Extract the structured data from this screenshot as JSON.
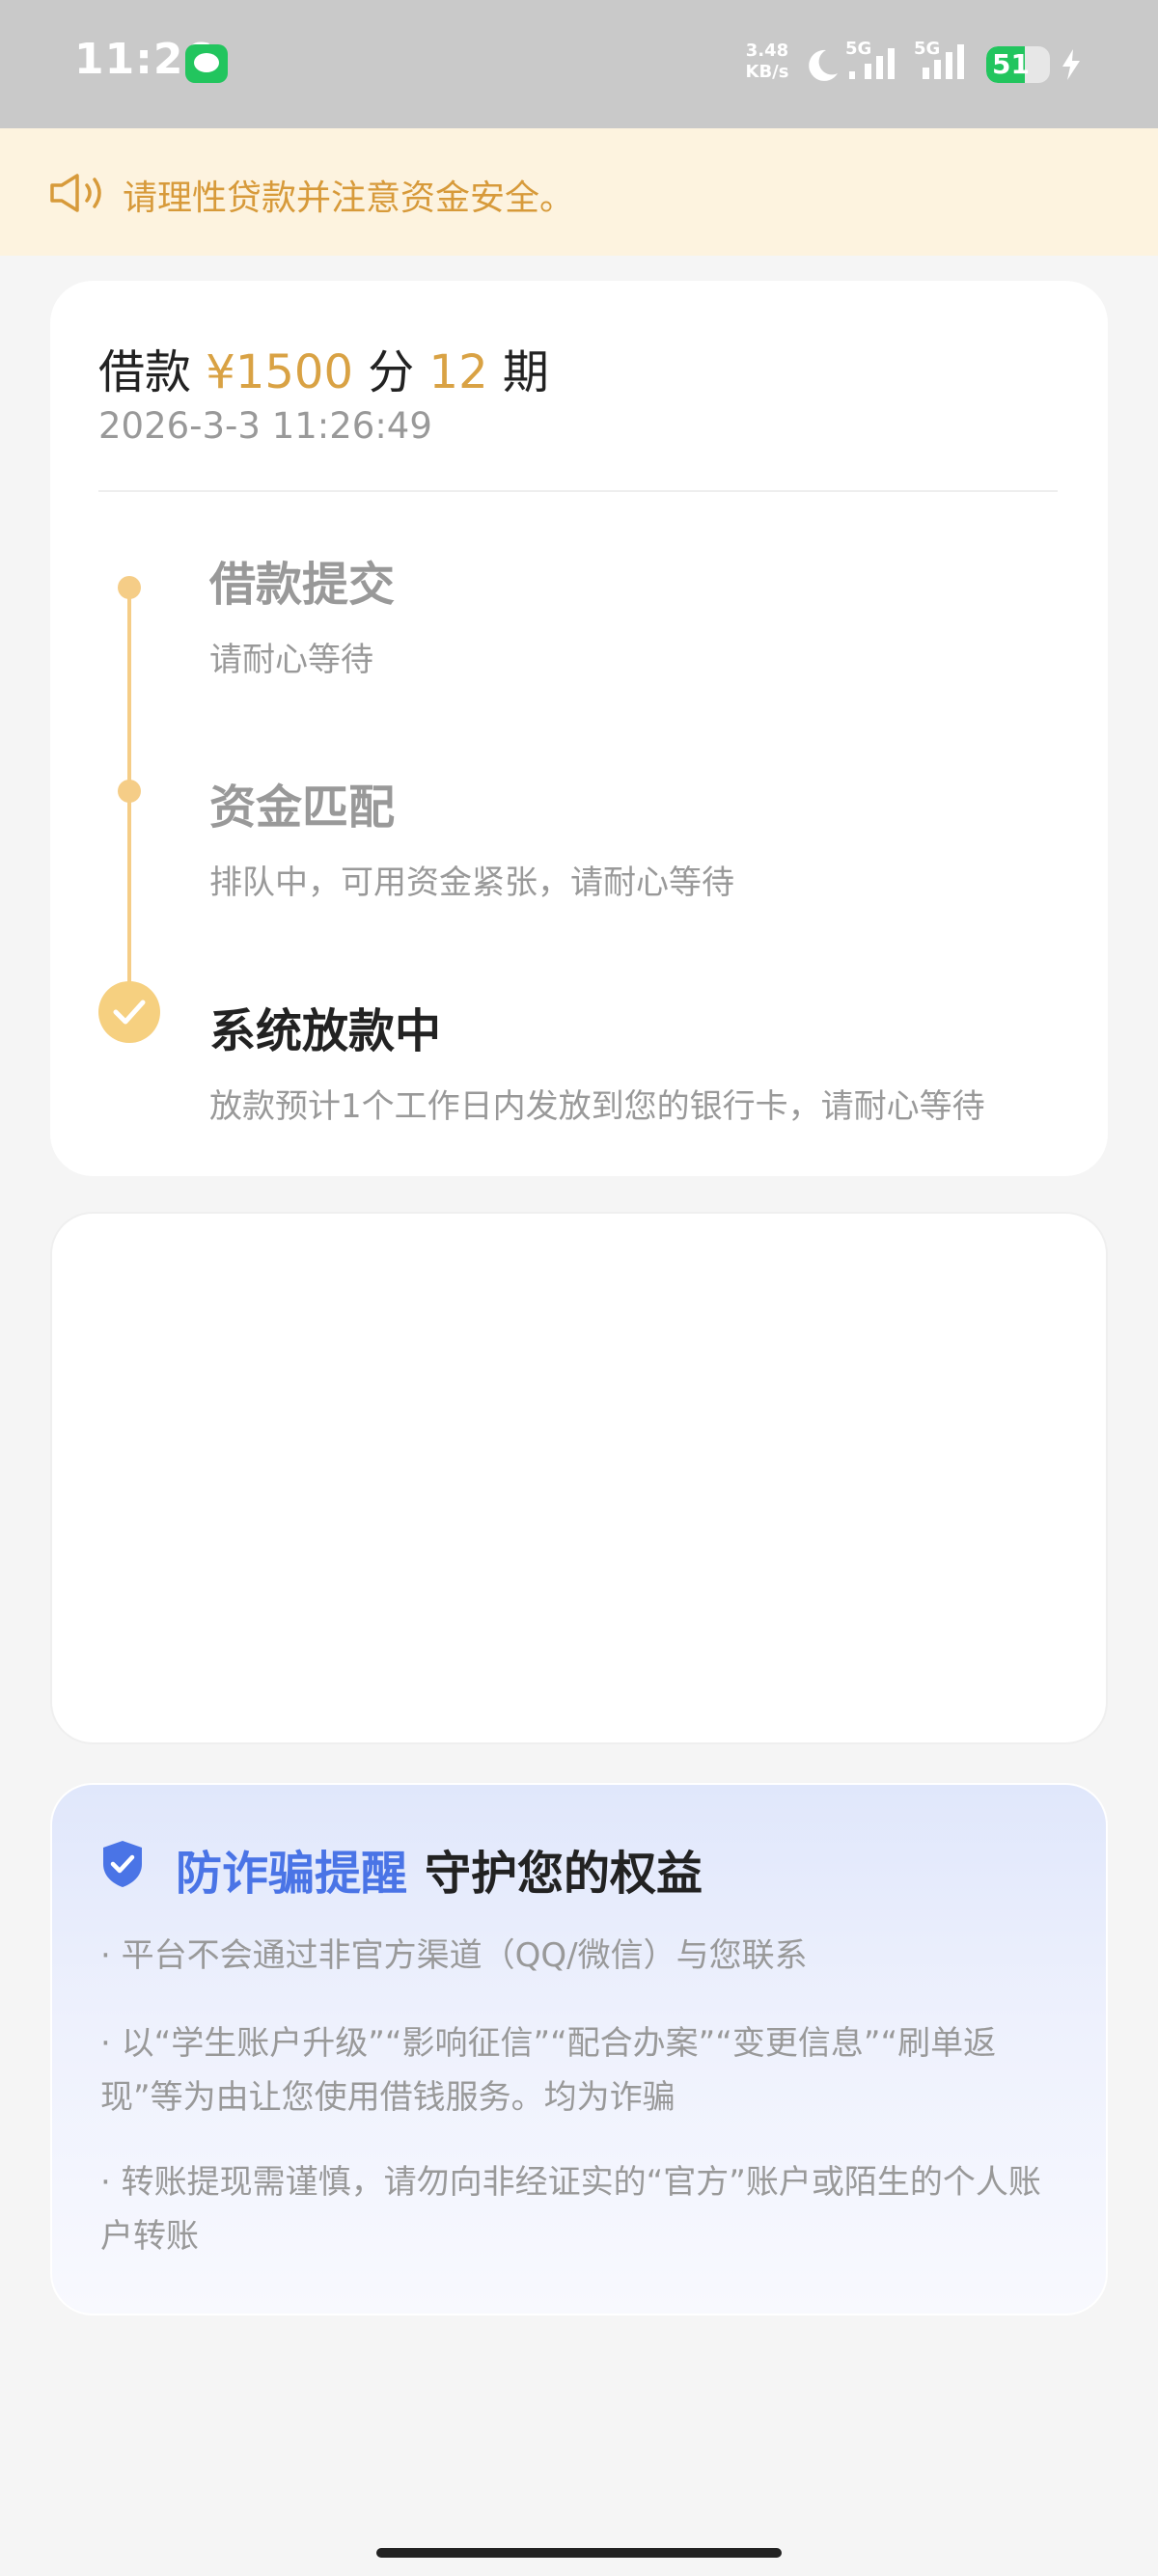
{
  "status_bar": {
    "time": "11:26",
    "speed_value": "3.48",
    "speed_unit": "KB/s",
    "network_1": "5G",
    "network_2": "5G",
    "battery_level": "51",
    "battery_color": "#22c55e"
  },
  "notice": {
    "text": "请理性贷款并注意资金安全。",
    "color": "#d79a3a"
  },
  "loan": {
    "prefix": "借款",
    "amount": "¥1500",
    "middle": "分",
    "periods": "12",
    "suffix": "期",
    "datetime": "2026-3-3 11:26:49",
    "accent_color": "#d9a244"
  },
  "timeline": [
    {
      "title": "借款提交",
      "desc": "请耐心等待"
    },
    {
      "title": "资金匹配",
      "desc": "排队中，可用资金紧张，请耐心等待"
    },
    {
      "title": "系统放款中",
      "desc": "放款预计1个工作日内发放到您的银行卡，请耐心等待"
    }
  ],
  "fraud": {
    "title_blue": "防诈骗提醒",
    "title_dark": "守护您的权益",
    "items": [
      "· 平台不会通过非官方渠道（QQ/微信）与您联系",
      "· 以“学生账户升级”“影响征信”“配合办案”“变更信息”“刷单返现”等为由让您使用借钱服务。均为诈骗",
      "· 转账提现需谨慎，请勿向非经证实的“官方”账户或陌生的个人账户转账"
    ],
    "accent_color": "#4a74e6"
  }
}
